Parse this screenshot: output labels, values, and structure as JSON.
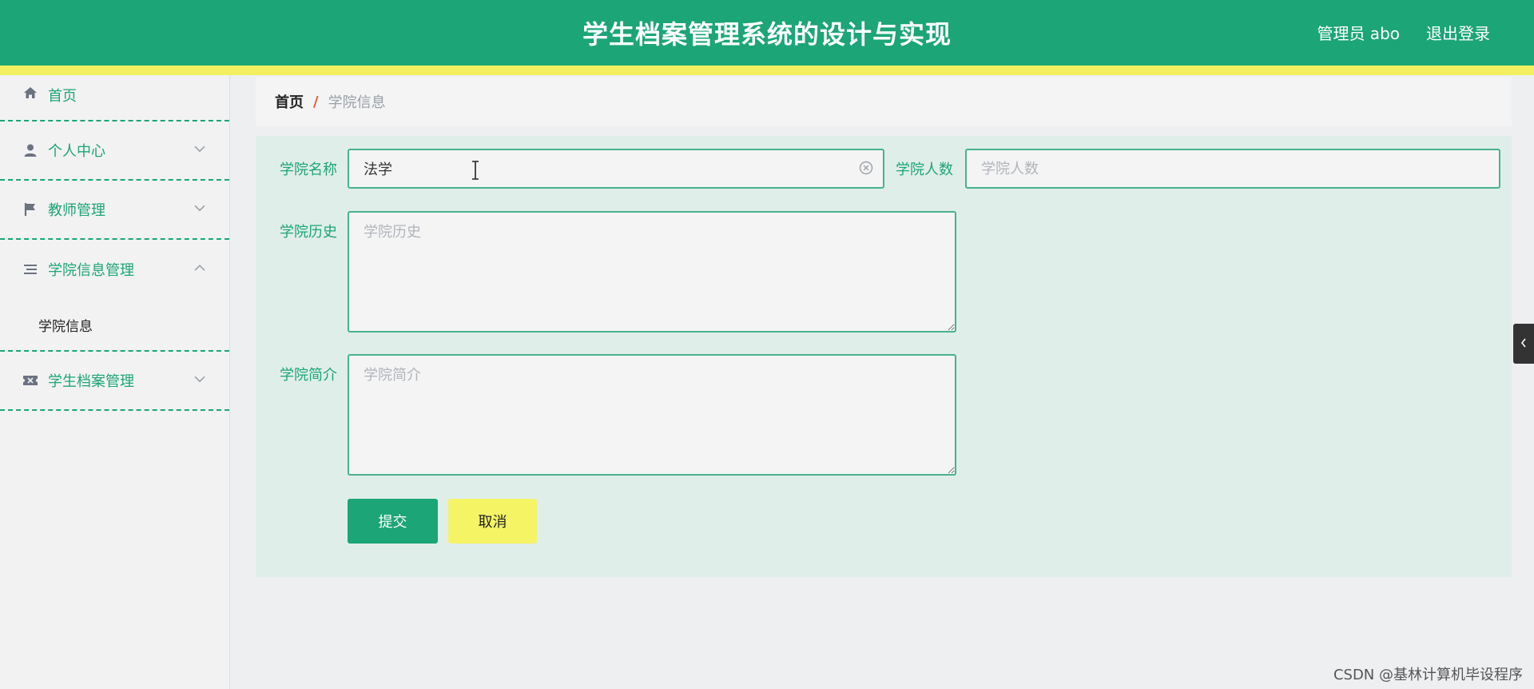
{
  "header": {
    "title": "学生档案管理系统的设计与实现",
    "user": "管理员 abo",
    "logout": "退出登录"
  },
  "sidebar": {
    "items": [
      {
        "label": "首页",
        "icon": "home-icon"
      },
      {
        "label": "个人中心",
        "icon": "user-icon"
      },
      {
        "label": "教师管理",
        "icon": "flag-icon"
      },
      {
        "label": "学院信息管理",
        "icon": "list-icon",
        "open": true,
        "children": [
          {
            "label": "学院信息"
          }
        ]
      },
      {
        "label": "学生档案管理",
        "icon": "ticket-icon"
      }
    ]
  },
  "breadcrumb": {
    "home": "首页",
    "separator": "/",
    "current": "学院信息"
  },
  "form": {
    "name_label": "学院名称",
    "name_value": "法学",
    "count_label": "学院人数",
    "count_placeholder": "学院人数",
    "history_label": "学院历史",
    "history_placeholder": "学院历史",
    "intro_label": "学院简介",
    "intro_placeholder": "学院简介",
    "submit_label": "提交",
    "cancel_label": "取消"
  },
  "watermark": "CSDN @基林计算机毕设程序",
  "colors": {
    "primary": "#1ca576",
    "accent_yellow": "#f2f060"
  }
}
